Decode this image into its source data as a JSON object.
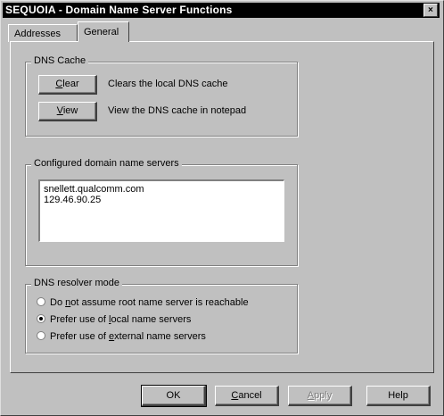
{
  "window": {
    "title": "SEQUOIA - Domain Name Server Functions",
    "close_glyph": "×"
  },
  "tabs": [
    {
      "label": "Addresses"
    },
    {
      "label": "General",
      "selected": true
    }
  ],
  "dns_cache": {
    "group_label": "DNS Cache",
    "clear_button": {
      "mnemonic": "C",
      "rest": "lear"
    },
    "clear_desc": "Clears the local DNS cache",
    "view_button": {
      "mnemonic": "V",
      "rest": "iew"
    },
    "view_desc": "View the DNS cache in notepad"
  },
  "configured_servers": {
    "group_label": "Configured domain name servers",
    "entries": [
      "snellett.qualcomm.com",
      "129.46.90.25"
    ]
  },
  "resolver_mode": {
    "group_label": "DNS resolver mode",
    "options": [
      {
        "pre": "Do ",
        "mnemonic": "n",
        "post": "ot assume root name server is reachable",
        "checked": false
      },
      {
        "pre": "Prefer use of ",
        "mnemonic": "l",
        "post": "ocal name servers",
        "checked": true
      },
      {
        "pre": "Prefer use of ",
        "mnemonic": "e",
        "post": "xternal name servers",
        "checked": false
      }
    ]
  },
  "footer": {
    "ok": "OK",
    "cancel": {
      "mnemonic": "C",
      "rest": "ancel"
    },
    "apply": {
      "mnemonic": "A",
      "rest": "pply"
    },
    "help": "Help"
  }
}
